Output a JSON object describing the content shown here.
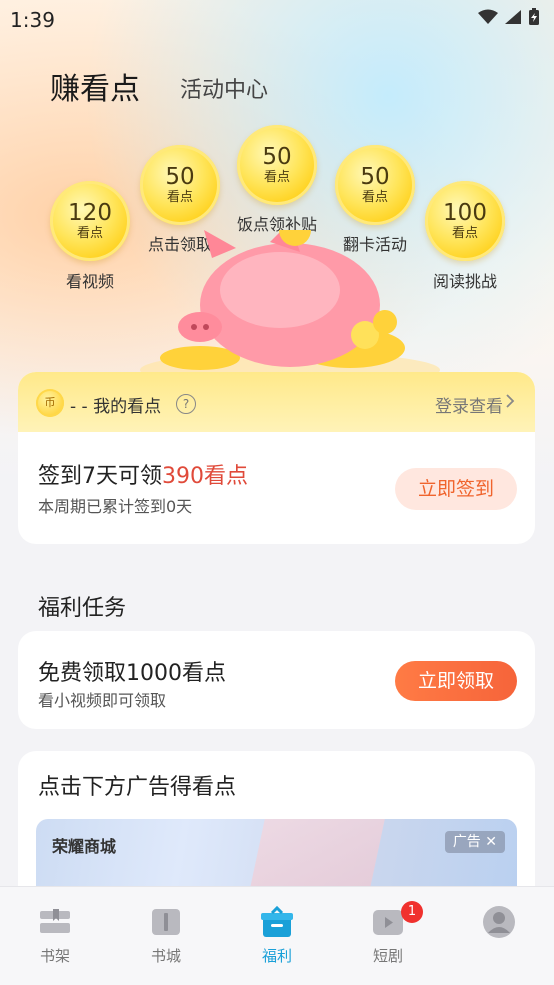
{
  "status": {
    "time": "1:39"
  },
  "header": {
    "title": "赚看点",
    "tab": "活动中心"
  },
  "coins": [
    {
      "value": "120",
      "unit": "看点",
      "label": "看视频"
    },
    {
      "value": "50",
      "unit": "看点",
      "label": "点击领取"
    },
    {
      "value": "50",
      "unit": "看点",
      "label": "饭点领补贴"
    },
    {
      "value": "50",
      "unit": "看点",
      "label": "翻卡活动"
    },
    {
      "value": "100",
      "unit": "看点",
      "label": "阅读挑战"
    }
  ],
  "points_card": {
    "coin_glyph": "币",
    "title": "- - 我的看点",
    "login": "登录查看",
    "signin_prefix": "签到7天可领",
    "signin_highlight": "390看点",
    "signin_sub": "本周期已累计签到0天",
    "signin_button": "立即签到"
  },
  "section": {
    "title": "福利任务"
  },
  "task": {
    "title": "免费领取1000看点",
    "sub": "看小视频即可领取",
    "button": "立即领取"
  },
  "ad": {
    "title": "点击下方广告得看点",
    "brand": "荣耀商城",
    "badge": "广告 ✕"
  },
  "nav": [
    {
      "label": "书架",
      "icon": "bookshelf-icon"
    },
    {
      "label": "书城",
      "icon": "book-icon"
    },
    {
      "label": "福利",
      "icon": "gift-icon",
      "active": true
    },
    {
      "label": "短剧",
      "icon": "play-icon",
      "badge": "1"
    },
    {
      "label": "",
      "icon": "avatar-icon"
    }
  ],
  "colors": {
    "accent": "#1aa0d8",
    "orange": "#f6643a",
    "highlight": "#e04a3a"
  }
}
